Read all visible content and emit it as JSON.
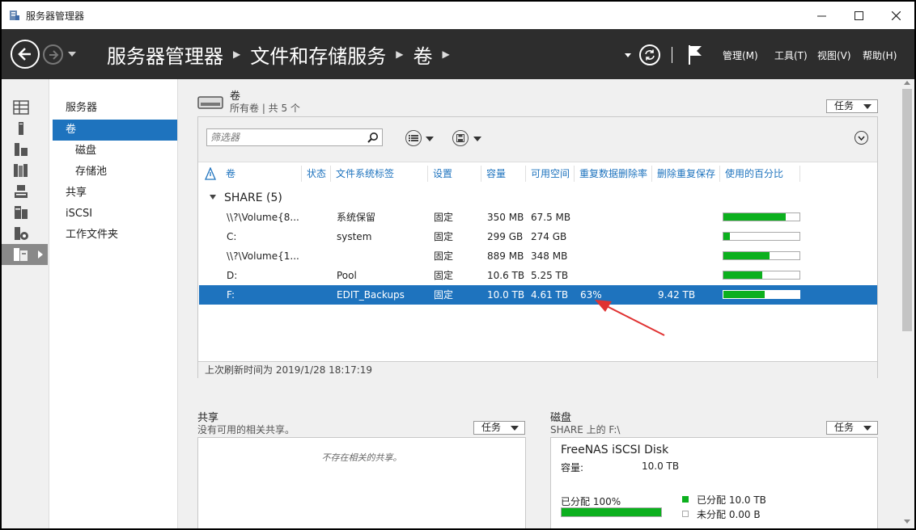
{
  "window": {
    "title": "服务器管理器"
  },
  "colors": {
    "accent": "#1e73be",
    "bar_green": "#0cb01e",
    "header": "#2d2d2d",
    "annotation": "#e03232"
  },
  "header": {
    "breadcrumb": [
      "服务器管理器",
      "文件和存储服务",
      "卷"
    ],
    "menus": [
      "管理(M)",
      "工具(T)",
      "视图(V)",
      "帮助(H)"
    ]
  },
  "nav": {
    "items": [
      {
        "label": "服务器"
      },
      {
        "label": "卷"
      },
      {
        "label": "磁盘"
      },
      {
        "label": "存储池"
      },
      {
        "label": "共享"
      },
      {
        "label": "iSCSI"
      },
      {
        "label": "工作文件夹"
      }
    ]
  },
  "volumes": {
    "title": "卷",
    "subtitle": "所有卷 | 共 5 个",
    "tasks_label": "任务",
    "filter_placeholder": "筛选器",
    "columns": [
      "卷",
      "状态",
      "文件系统标签",
      "设置",
      "容量",
      "可用空间",
      "重复数据删除率",
      "删除重复保存",
      "使用的百分比"
    ],
    "group": "SHARE (5)",
    "rows": [
      {
        "volume": "\\\\?\\Volume{8...",
        "status": "",
        "label": "系统保留",
        "setting": "固定",
        "capacity": "350 MB",
        "free": "67.5 MB",
        "dedup_rate": "",
        "dedup_saved": "",
        "used_percent": 82
      },
      {
        "volume": "C:",
        "status": "",
        "label": "system",
        "setting": "固定",
        "capacity": "299 GB",
        "free": "274 GB",
        "dedup_rate": "",
        "dedup_saved": "",
        "used_percent": 9
      },
      {
        "volume": "\\\\?\\Volume{1...",
        "status": "",
        "label": "",
        "setting": "固定",
        "capacity": "889 MB",
        "free": "348 MB",
        "dedup_rate": "",
        "dedup_saved": "",
        "used_percent": 61
      },
      {
        "volume": "D:",
        "status": "",
        "label": "Pool",
        "setting": "固定",
        "capacity": "10.6 TB",
        "free": "5.25 TB",
        "dedup_rate": "",
        "dedup_saved": "",
        "used_percent": 51
      },
      {
        "volume": "F:",
        "status": "",
        "label": "EDIT_Backups",
        "setting": "固定",
        "capacity": "10.0 TB",
        "free": "4.61 TB",
        "dedup_rate": "63%",
        "dedup_saved": "9.42 TB",
        "used_percent": 54
      }
    ],
    "selected_row": 4,
    "last_refresh": "上次刷新时间为 2019/1/28 18:17:19"
  },
  "shares": {
    "title": "共享",
    "subtitle": "没有可用的相关共享。",
    "tasks_label": "任务",
    "empty_text": "不存在相关的共享。"
  },
  "disk": {
    "title": "磁盘",
    "subtitle": "SHARE 上的 F:\\",
    "tasks_label": "任务",
    "name": "FreeNAS iSCSI Disk",
    "capacity_label": "容量:",
    "capacity_value": "10.0 TB",
    "allocated_text": "已分配 100%",
    "allocated_percent": 100,
    "legend_allocated": "已分配 10.0 TB",
    "legend_unallocated": "未分配 0.00 B"
  }
}
